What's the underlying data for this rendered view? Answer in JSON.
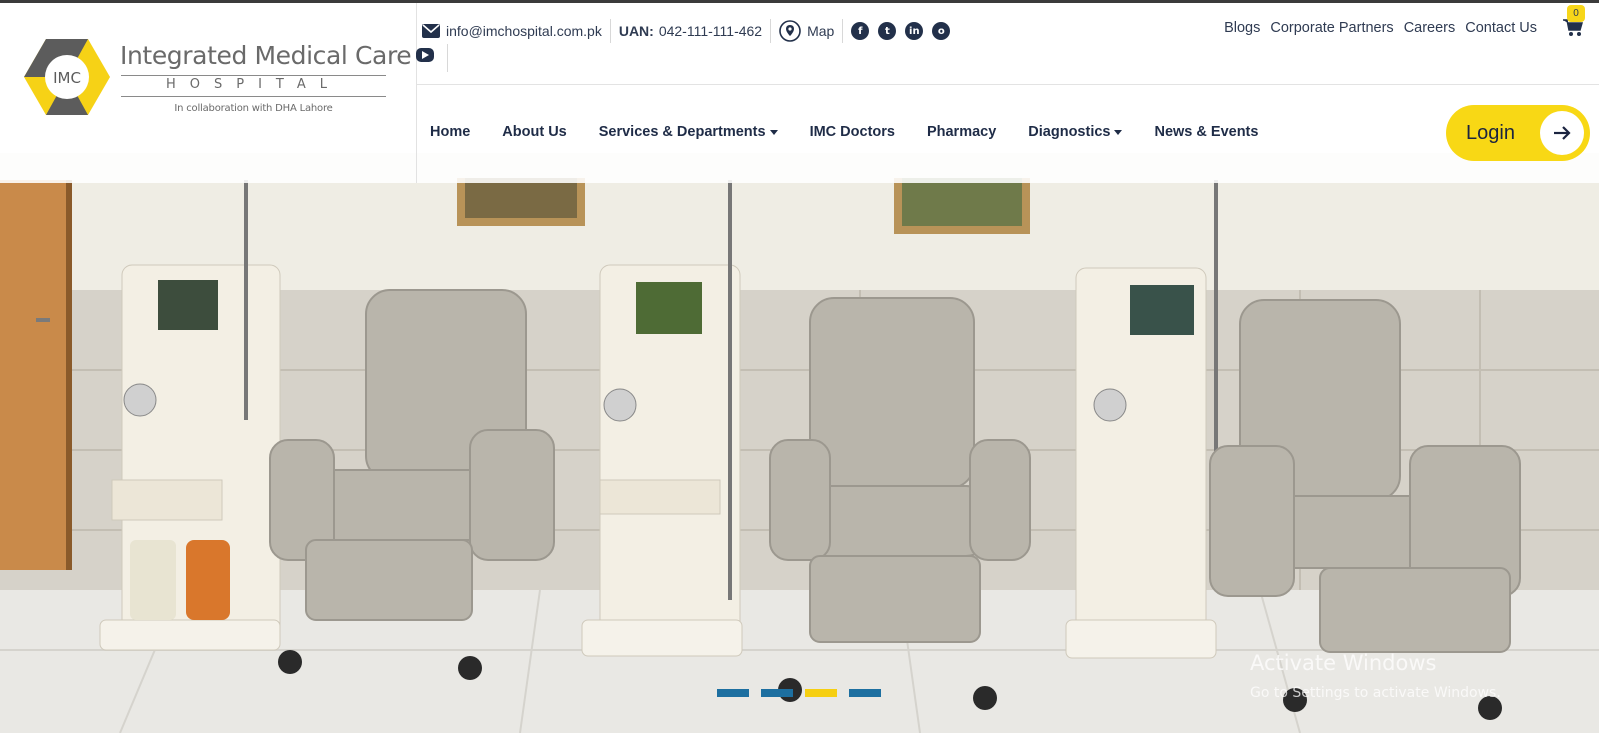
{
  "brand": {
    "logo_text": "IMC",
    "title": "Integrated Medical Care",
    "subtitle": "HOSPITAL",
    "collab": "In collaboration with DHA Lahore"
  },
  "contact": {
    "email": "info@imchospital.com.pk",
    "uan_label": "UAN:",
    "uan_number": "042-111-111-462",
    "map_label": "Map"
  },
  "top_links": [
    "Blogs",
    "Corporate Partners",
    "Careers",
    "Contact Us"
  ],
  "cart": {
    "count": "0"
  },
  "nav": {
    "items": [
      {
        "label": "Home",
        "dropdown": false
      },
      {
        "label": "About Us",
        "dropdown": false
      },
      {
        "label": "Services & Departments",
        "dropdown": true
      },
      {
        "label": "IMC Doctors",
        "dropdown": false
      },
      {
        "label": "Pharmacy",
        "dropdown": false
      },
      {
        "label": "Diagnostics",
        "dropdown": true
      },
      {
        "label": "News & Events",
        "dropdown": false
      }
    ]
  },
  "login": {
    "label": "Login"
  },
  "slider": {
    "slide_count": 4,
    "active_index": 2
  },
  "watermark": {
    "title": "Activate Windows",
    "subtitle": "Go to Settings to activate Windows."
  },
  "colors": {
    "accent": "#f8d815",
    "navy": "#1f2c47",
    "slider_dot": "#1d6fa0"
  }
}
